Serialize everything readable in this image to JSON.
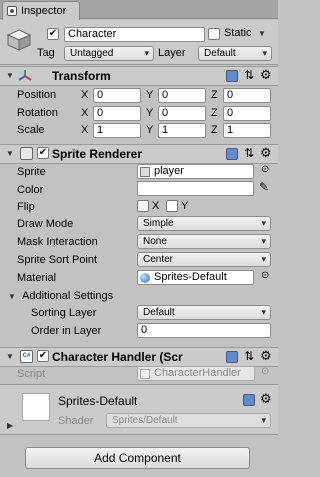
{
  "tab": {
    "title": "Inspector"
  },
  "gameobject": {
    "active": true,
    "name": "Character",
    "static_label": "Static",
    "static_checked": false,
    "tag_label": "Tag",
    "tag_value": "Untagged",
    "layer_label": "Layer",
    "layer_value": "Default"
  },
  "transform": {
    "title": "Transform",
    "position_label": "Position",
    "rotation_label": "Rotation",
    "scale_label": "Scale",
    "axes": [
      "X",
      "Y",
      "Z"
    ],
    "position": [
      "0",
      "0",
      "0"
    ],
    "rotation": [
      "0",
      "0",
      "0"
    ],
    "scale": [
      "1",
      "1",
      "1"
    ]
  },
  "sprite_renderer": {
    "enabled": true,
    "title": "Sprite Renderer",
    "sprite_label": "Sprite",
    "sprite_value": "player",
    "color_label": "Color",
    "color_value": "#ffffff",
    "flip_label": "Flip",
    "flip_x": "X",
    "flip_y": "Y",
    "draw_mode_label": "Draw Mode",
    "draw_mode_value": "Simple",
    "mask_label": "Mask Interaction",
    "mask_value": "None",
    "sort_point_label": "Sprite Sort Point",
    "sort_point_value": "Center",
    "material_label": "Material",
    "material_value": "Sprites-Default",
    "additional_label": "Additional Settings",
    "sorting_layer_label": "Sorting Layer",
    "sorting_layer_value": "Default",
    "order_label": "Order in Layer",
    "order_value": "0"
  },
  "character_handler": {
    "enabled": true,
    "title": "Character Handler (Scr",
    "script_label": "Script",
    "script_value": "CharacterHandler"
  },
  "material": {
    "name": "Sprites-Default",
    "shader_label": "Shader",
    "shader_value": "Sprites/Default"
  },
  "add_component": {
    "label": "Add Component"
  }
}
